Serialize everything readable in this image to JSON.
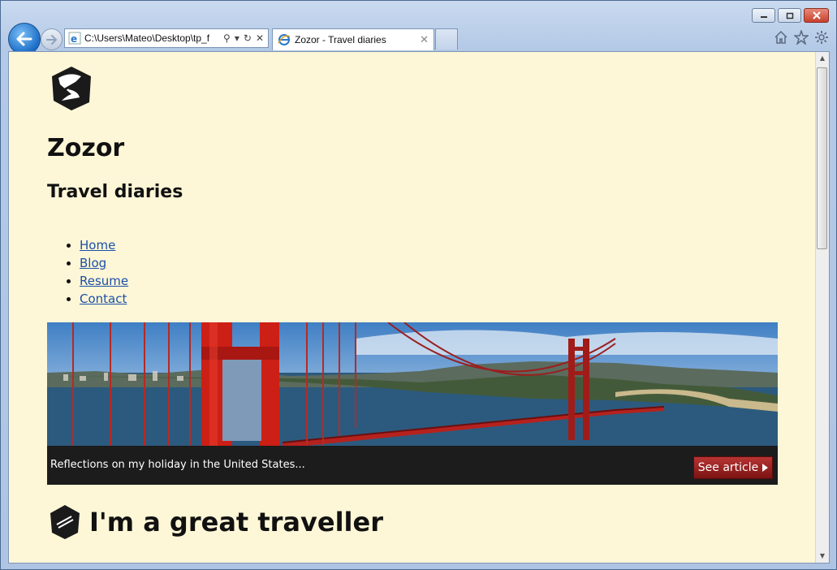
{
  "browser": {
    "address": "C:\\Users\\Mateo\\Desktop\\tp_f",
    "tab_title": "Zozor - Travel diaries"
  },
  "site": {
    "title": "Zozor",
    "subtitle": "Travel diaries"
  },
  "menu": [
    {
      "label": "Home"
    },
    {
      "label": "Blog"
    },
    {
      "label": "Resume"
    },
    {
      "label": "Contact"
    }
  ],
  "banner": {
    "caption": "Reflections on my holiday in the United States...",
    "button_label": "See article"
  },
  "article": {
    "heading": "I'm a great traveller"
  },
  "colors": {
    "page_bg": "#fef7d7",
    "link": "#1b4fa8",
    "button_red": "#a02222",
    "banner_bar": "#1c1c1c"
  }
}
